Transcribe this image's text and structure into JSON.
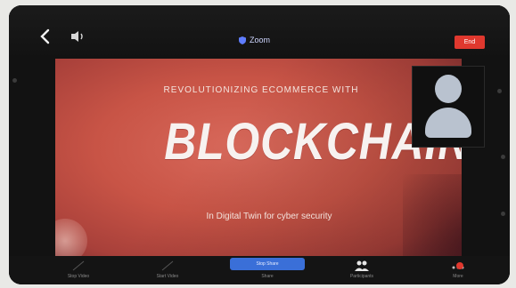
{
  "topbar": {
    "back_icon": "chevron-left-icon",
    "speaker_icon": "speaker-icon",
    "meeting_title": "Zoom",
    "end_label": "End"
  },
  "slide": {
    "heading": "REVOLUTIONIZING ECOMMERCE WITH",
    "title": "BLOCKCHAIN",
    "subtitle": "In Digital Twin for cyber security"
  },
  "self_view": {
    "avatar_icon": "user-avatar-icon"
  },
  "toolbar": {
    "items": [
      {
        "label": "Stop Video",
        "icon": "video-icon"
      },
      {
        "label": "Start Video",
        "icon": "video-icon"
      },
      {
        "label": "Share",
        "icon": "share-icon"
      },
      {
        "label": "Participants",
        "icon": "participants-icon"
      },
      {
        "label": "More",
        "icon": "more-icon"
      }
    ],
    "share_pill": "Stop Share"
  },
  "colors": {
    "slide_bg": "#c85446",
    "end_button": "#e0382e",
    "share_pill": "#3a6fd8"
  }
}
